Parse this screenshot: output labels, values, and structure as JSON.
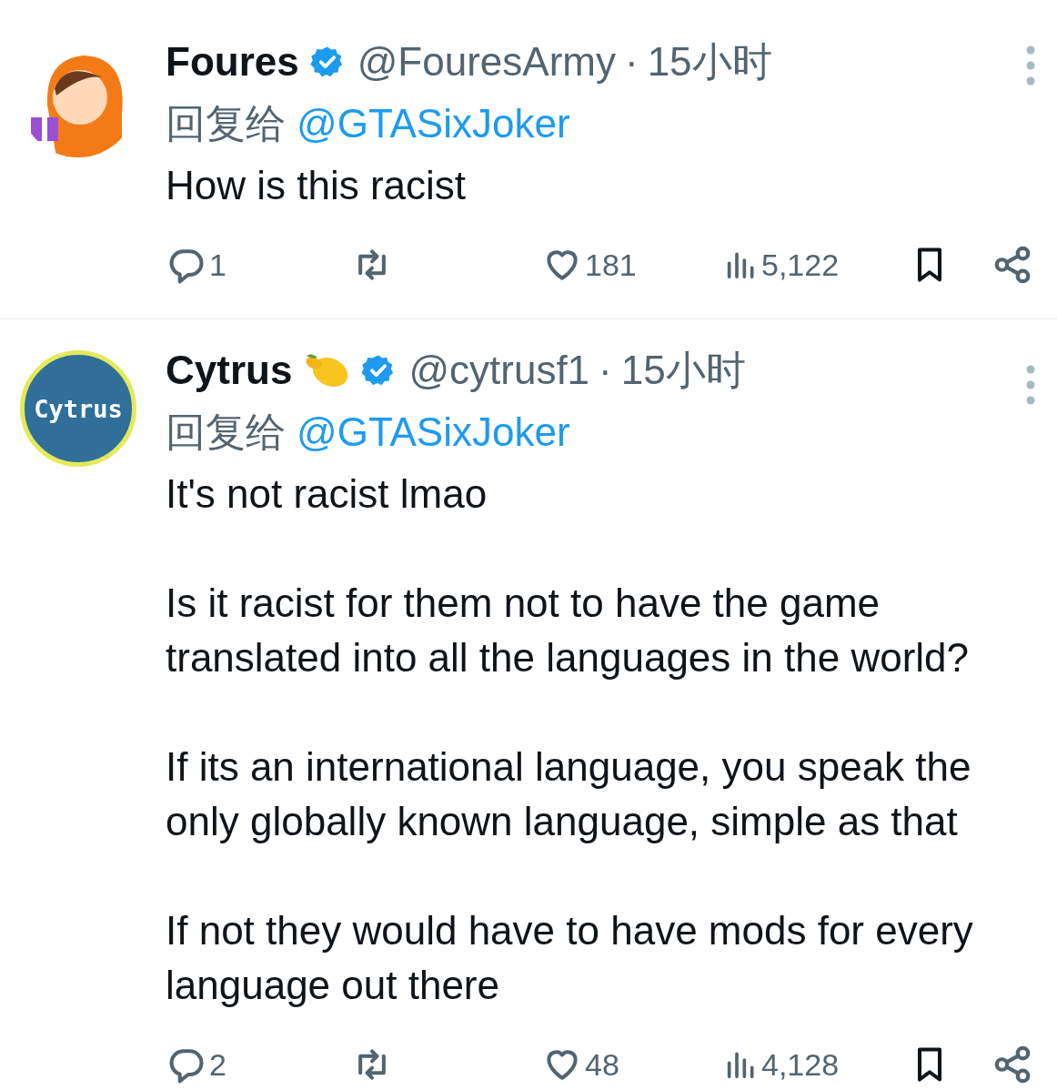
{
  "tweets": [
    {
      "avatar": {
        "kind": "cartoon"
      },
      "name": "Foures",
      "lemon": false,
      "verified": true,
      "handle": "@FouresArmy",
      "separator": "·",
      "time": "15小时",
      "reply_prefix": "回复给",
      "reply_to": "@GTASixJoker",
      "body": [
        "How is this racist"
      ],
      "actions": {
        "replies": "1",
        "likes": "181",
        "views": "5,122"
      }
    },
    {
      "avatar": {
        "kind": "logo",
        "text": "Cytrus"
      },
      "name": "Cytrus",
      "lemon": true,
      "verified": true,
      "handle": "@cytrusf1",
      "separator": "·",
      "time": "15小时",
      "reply_prefix": "回复给",
      "reply_to": "@GTASixJoker",
      "body": [
        "It's not racist lmao",
        "Is it racist for them not to have the game translated into all the languages in the world?",
        "If its an international language, you speak the only globally known language, simple as that",
        "If not they would have to have mods for every language out there"
      ],
      "actions": {
        "replies": "2",
        "likes": "48",
        "views": "4,128"
      }
    }
  ]
}
